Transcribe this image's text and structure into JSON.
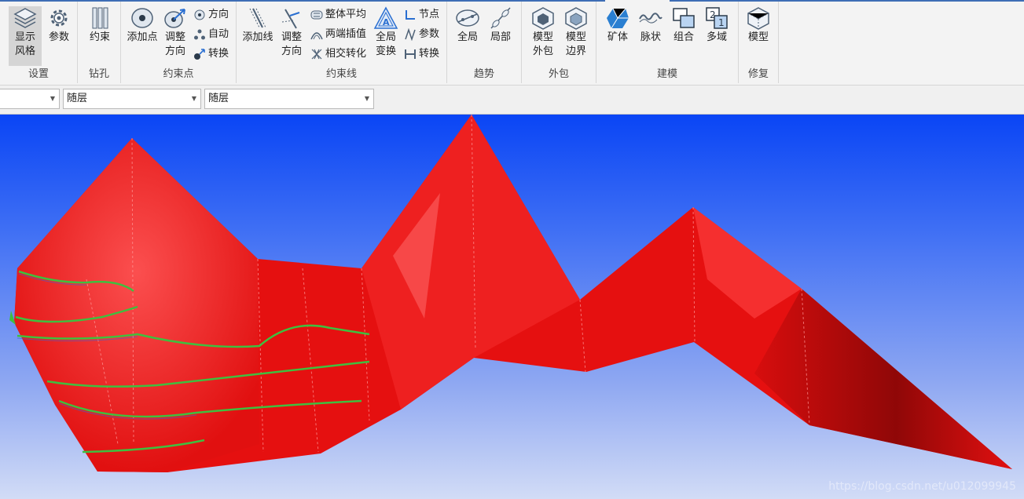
{
  "ribbon": {
    "groups": {
      "settings": {
        "label": "设置",
        "show_grid": "显示\n风格",
        "params": "参数"
      },
      "drill": {
        "label": "钻孔",
        "constraint": "约束"
      },
      "constraint_point": {
        "label": "约束点",
        "add_point": "添加点",
        "adjust_dir_line1": "调整",
        "adjust_dir_line2": "方向",
        "direction": "方向",
        "auto": "自动",
        "convert": "转换"
      },
      "constraint_line": {
        "label": "约束线",
        "add_line": "添加线",
        "adjust_dir_line1": "调整",
        "adjust_dir_line2": "方向",
        "overall_avg": "整体平均",
        "ends_interp": "两端插值",
        "intersect": "相交转化",
        "global_line1": "全局",
        "global_line2": "变换",
        "node": "节点",
        "param": "参数",
        "convert": "转换"
      },
      "trend": {
        "label": "趋势",
        "global": "全局",
        "local": "局部"
      },
      "hull": {
        "label": "外包",
        "model_hull_line1": "模型",
        "model_hull_line2": "外包",
        "model_bound_line1": "模型",
        "model_bound_line2": "边界"
      },
      "modeling": {
        "label": "建模",
        "ore": "矿体",
        "vein": "脉状",
        "combine": "组合",
        "multi": "多域"
      },
      "repair": {
        "label": "修复",
        "model": "模型"
      }
    }
  },
  "propbar": {
    "combo1": "",
    "combo2": "随层",
    "combo3": "随层"
  },
  "viewport": {
    "watermark": "https://blog.csdn.net/u012099945",
    "surface_color": "#e81010",
    "line_color": "#3fbf3f"
  }
}
